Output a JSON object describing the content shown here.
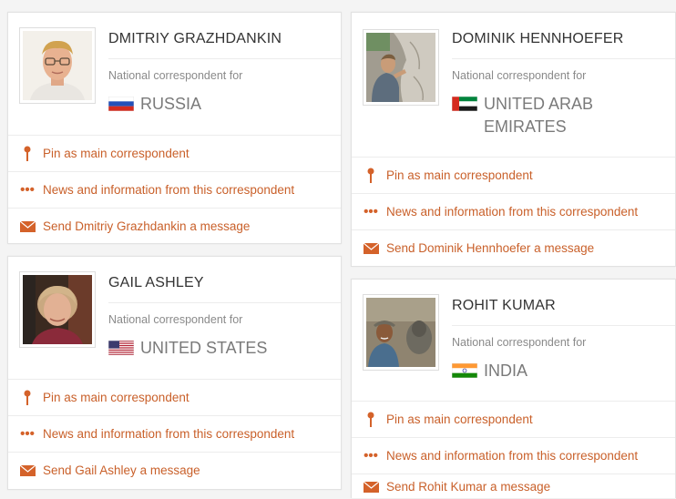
{
  "cards": [
    {
      "name": "DMITRIY GRAZHDANKIN",
      "role": "National correspondent for",
      "country": "RUSSIA",
      "flag": "russia-flag",
      "photo": "dmitriy-portrait",
      "actions": {
        "pin": "Pin as main correspondent",
        "news": "News and information from this correspondent",
        "message": "Send Dmitriy Grazhdankin a message"
      }
    },
    {
      "name": "DOMINIK HENNHOEFER",
      "role": "National correspondent for",
      "country": "UNITED ARAB EMIRATES",
      "flag": "uae-flag",
      "photo": "dominik-portrait",
      "actions": {
        "pin": "Pin as main correspondent",
        "news": "News and information from this correspondent",
        "message": "Send Dominik Hennhoefer a message"
      }
    },
    {
      "name": "GAIL ASHLEY",
      "role": "National correspondent for",
      "country": "UNITED STATES",
      "flag": "usa-flag",
      "photo": "gail-portrait",
      "actions": {
        "pin": "Pin as main correspondent",
        "news": "News and information from this correspondent",
        "message": "Send Gail Ashley a message"
      }
    },
    {
      "name": "ROHIT KUMAR",
      "role": "National correspondent for",
      "country": "INDIA",
      "flag": "india-flag",
      "photo": "rohit-portrait",
      "actions": {
        "pin": "Pin as main correspondent",
        "news": "News and information from this correspondent",
        "message": "Send Rohit Kumar a message"
      }
    }
  ],
  "colors": {
    "accent": "#d4622a",
    "name_text": "#333333",
    "muted_text": "#8a8a8a"
  },
  "icons": {
    "pin": "pin-icon",
    "news": "dots-icon",
    "message": "envelope-icon"
  }
}
